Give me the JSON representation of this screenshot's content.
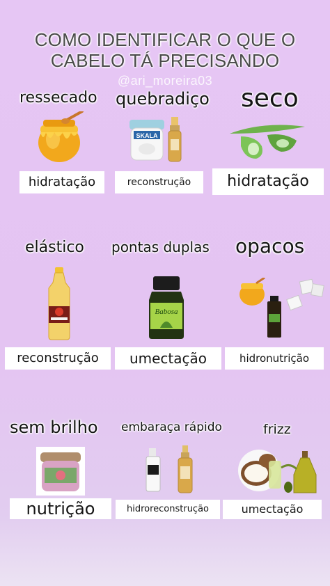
{
  "title": {
    "line1": "COMO IDENTIFICAR O QUE O",
    "line2": "CABELO TÁ PRECISANDO",
    "handle": "@ari_moreira03"
  },
  "row1": {
    "labels": [
      "ressecado",
      "quebradiço",
      "seco"
    ],
    "treatments": [
      "hidratação",
      "reconstrução",
      "hidratação"
    ],
    "icons": [
      "honey-pot-icon",
      "skala-cream-jar-icon",
      "aloe-vera-icon"
    ]
  },
  "row2": {
    "labels": [
      "elástico",
      "pontas duplas",
      "opacos"
    ],
    "treatments": [
      "reconstrução",
      "umectação",
      "hidronutrição"
    ],
    "icons": [
      "cooking-oil-bottle-icon",
      "babosa-capsule-bottle-icon",
      "honey-sugar-cubes-icon"
    ]
  },
  "row3": {
    "labels": [
      "sem brilho",
      "embaraça rápido",
      "frizz"
    ],
    "treatments": [
      "nutrição",
      "hidroreconstrução",
      "umectação"
    ],
    "icons": [
      "mask-jar-icon",
      "serum-bottles-icon",
      "coconut-olive-oil-icon"
    ]
  },
  "product_text": {
    "skala": "SKALA",
    "babosa": "Babosa"
  }
}
